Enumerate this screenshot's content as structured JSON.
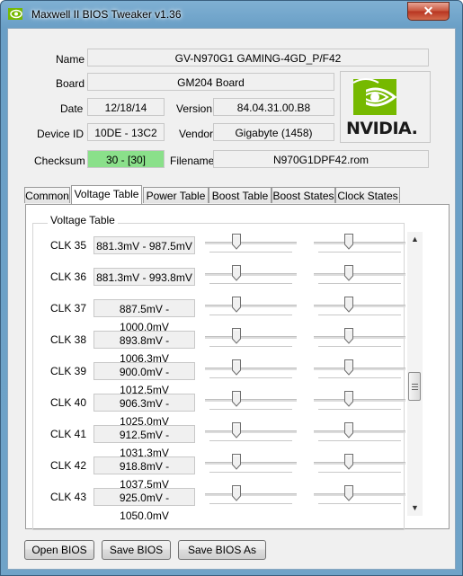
{
  "window": {
    "title": "Maxwell II BIOS Tweaker v1.36",
    "close_glyph": "✕",
    "icon": "nvidia-eye-icon"
  },
  "info": {
    "name_label": "Name",
    "name_value": "GV-N970G1 GAMING-4GD_P/F42",
    "board_label": "Board",
    "board_value": "GM204 Board",
    "date_label": "Date",
    "date_value": "12/18/14",
    "version_label": "Version",
    "version_value": "84.04.31.00.B8",
    "device_id_label": "Device ID",
    "device_id_value": "10DE - 13C2",
    "vendor_label": "Vendor",
    "vendor_value": "Gigabyte (1458)",
    "checksum_label": "Checksum",
    "checksum_value": "30 - [30]",
    "filename_label": "Filename",
    "filename_value": "N970G1DPF42.rom",
    "logo_text": "NVIDIA."
  },
  "tabs": [
    "Common",
    "Voltage Table",
    "Power Table",
    "Boost Table",
    "Boost States",
    "Clock States"
  ],
  "active_tab": "Voltage Table",
  "voltage_table": {
    "title": "Voltage Table",
    "rows": [
      {
        "clk": "CLK 35",
        "range": "881.3mV - 987.5mV"
      },
      {
        "clk": "CLK 36",
        "range": "881.3mV - 993.8mV"
      },
      {
        "clk": "CLK 37",
        "range": "887.5mV - 1000.0mV"
      },
      {
        "clk": "CLK 38",
        "range": "893.8mV - 1006.3mV"
      },
      {
        "clk": "CLK 39",
        "range": "900.0mV - 1012.5mV"
      },
      {
        "clk": "CLK 40",
        "range": "906.3mV - 1025.0mV"
      },
      {
        "clk": "CLK 41",
        "range": "912.5mV - 1031.3mV"
      },
      {
        "clk": "CLK 42",
        "range": "918.8mV - 1037.5mV"
      },
      {
        "clk": "CLK 43",
        "range": "925.0mV - 1050.0mV"
      }
    ],
    "scroll_up_glyph": "▲",
    "scroll_down_glyph": "▼"
  },
  "buttons": {
    "open": "Open BIOS",
    "save": "Save BIOS",
    "save_as": "Save BIOS As"
  },
  "colors": {
    "checksum_ok": "#8ae08a",
    "logo_green": "#76b900"
  }
}
